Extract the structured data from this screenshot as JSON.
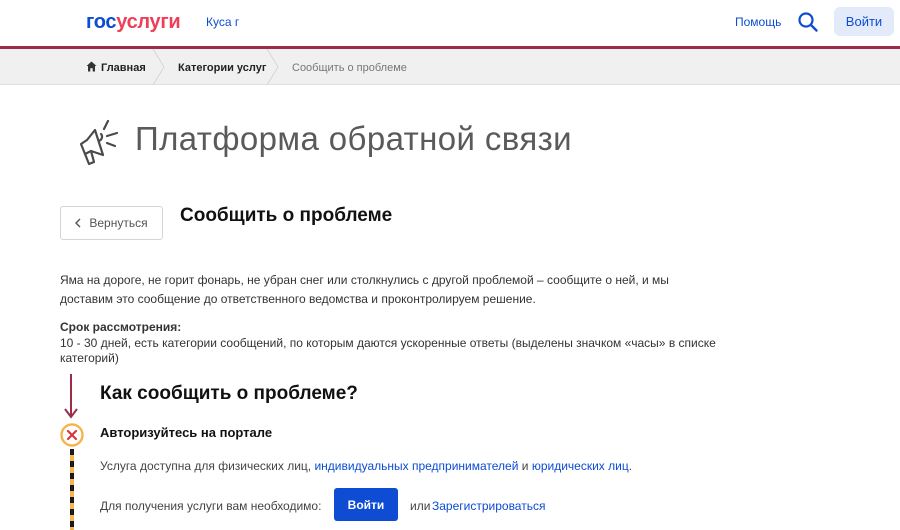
{
  "header": {
    "logo_part1": "гос",
    "logo_part2": "услуги",
    "location": "Куса г",
    "help": "Помощь",
    "login": "Войти"
  },
  "breadcrumb": {
    "items": [
      "Главная",
      "Категории услуг",
      "Сообщить о проблеме"
    ]
  },
  "page": {
    "title": "Платформа обратной связи",
    "back_label": "Вернуться",
    "section_title": "Сообщить о проблеме",
    "description": "Яма на дороге, не горит фонарь, не убран снег или столкнулись с другой проблемой – сообщите о ней, и мы доставим это сообщение до ответственного ведомства и проконтролируем решение.",
    "term_title": "Срок рассмотрения:",
    "term_text": "10 - 30 дней, есть категории сообщений, по которым даются ускоренные ответы (выделены значком «часы» в списке категорий)",
    "how_title": "Как сообщить о проблеме?"
  },
  "step": {
    "title": "Авторизуйтесь на портале",
    "desc_prefix": "Услуга доступна для физических лиц,",
    "link_ip": "индивидуальных предпринимателей",
    "desc_and": "и",
    "link_legal": "юридических лиц",
    "desc_end": ".",
    "need_text": "Для получения услуги вам необходимо:",
    "login_button": "Войти",
    "or_text": "или",
    "register_link": "Зарегистрироваться"
  },
  "colors": {
    "brand_blue": "#0d4cd3",
    "brand_red": "#ee3f58",
    "header_line": "#9b2d4a",
    "step_icon": "#f6b44a"
  },
  "icons": [
    "search-icon",
    "home-icon",
    "megaphone-icon",
    "chevron-left-icon",
    "arrow-down-icon",
    "close-circle-icon"
  ]
}
